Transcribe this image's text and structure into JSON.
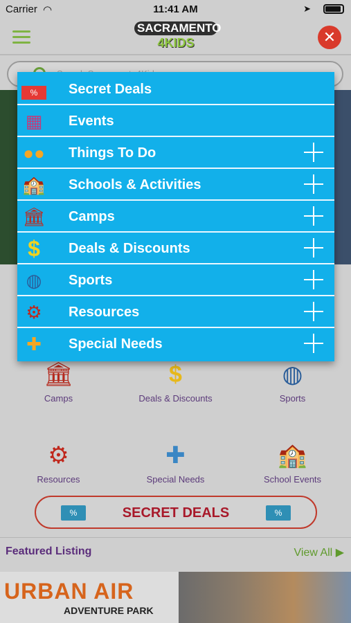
{
  "status": {
    "carrier": "Carrier",
    "time": "11:41 AM"
  },
  "header": {
    "logo_line1": "SACRAMENTO",
    "logo_line2": "4KIDS"
  },
  "search": {
    "placeholder": "Search Sacramento4Kids"
  },
  "menu": {
    "items": [
      {
        "label": "Secret Deals",
        "icon": "ticket-icon",
        "expandable": false
      },
      {
        "label": "Events",
        "icon": "calendar-icon",
        "expandable": false
      },
      {
        "label": "Things To Do",
        "icon": "people-icon",
        "expandable": true
      },
      {
        "label": "Schools & Activities",
        "icon": "school-icon",
        "expandable": true
      },
      {
        "label": "Camps",
        "icon": "building-icon",
        "expandable": true
      },
      {
        "label": "Deals & Discounts",
        "icon": "dollar-icon",
        "expandable": true
      },
      {
        "label": "Sports",
        "icon": "basketball-icon",
        "expandable": true
      },
      {
        "label": "Resources",
        "icon": "gears-icon",
        "expandable": true
      },
      {
        "label": "Special Needs",
        "icon": "puzzle-icon",
        "expandable": true
      }
    ]
  },
  "grid": [
    {
      "label": "Camps",
      "icon": "building-icon"
    },
    {
      "label": "Deals & Discounts",
      "icon": "dollar-icon"
    },
    {
      "label": "Sports",
      "icon": "basketball-icon"
    },
    {
      "label": "Resources",
      "icon": "gears-icon"
    },
    {
      "label": "Special Needs",
      "icon": "puzzle-icon"
    },
    {
      "label": "School Events",
      "icon": "school-building-icon"
    }
  ],
  "secret_deals_button": "SECRET DEALS",
  "featured": {
    "title": "Featured Listing",
    "view_all": "View All"
  },
  "ad": {
    "brand": "URBAN AIR",
    "subtitle": "ADVENTURE PARK"
  },
  "colors": {
    "menu_bg": "#12b0ea",
    "accent_green": "#7fb343",
    "close_red": "#d93a2b",
    "deals_red": "#a8192a"
  }
}
